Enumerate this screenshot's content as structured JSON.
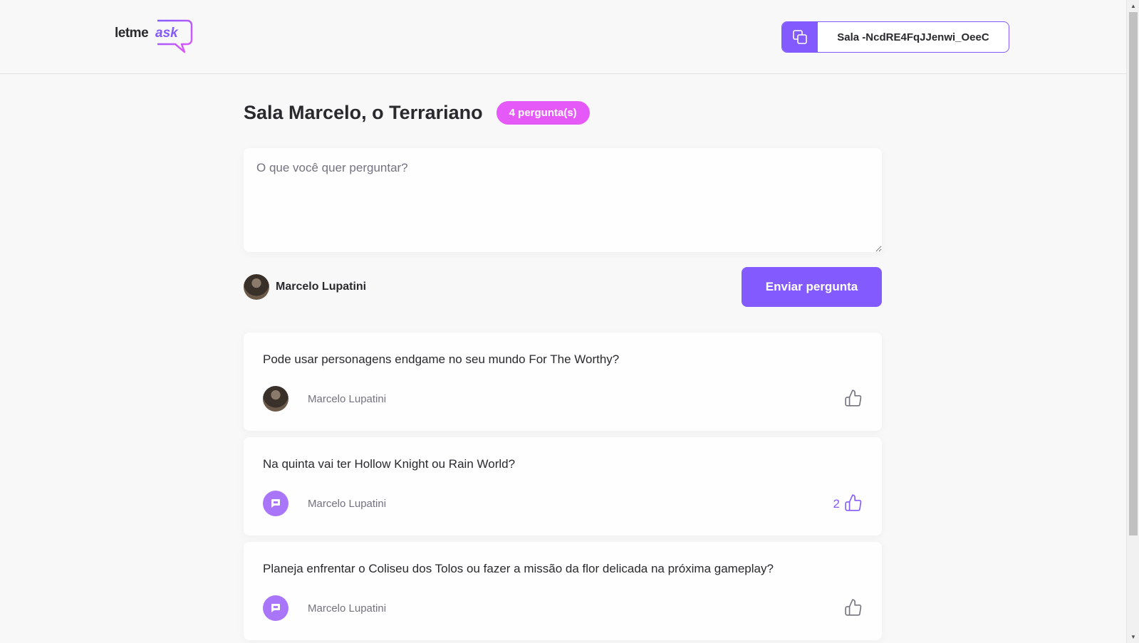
{
  "header": {
    "logo": {
      "prefix": "letme",
      "suffix": "ask"
    },
    "room_code_label": "Sala -NcdRE4FqJJenwi_OeeC",
    "copy_icon": "copy-icon"
  },
  "room": {
    "title": "Sala Marcelo, o Terrariano",
    "question_count": "4 pergunta(s)"
  },
  "form": {
    "placeholder": "O que você quer perguntar?",
    "user_name": "Marcelo Lupatini",
    "send_label": "Enviar pergunta"
  },
  "questions": [
    {
      "text": "Pode usar personagens endgame no seu mundo For The Worthy?",
      "author": "Marcelo Lupatini",
      "avatar": "photo",
      "likes": ""
    },
    {
      "text": "Na quinta vai ter Hollow Knight ou Rain World?",
      "author": "Marcelo Lupatini",
      "avatar": "default",
      "likes": "2"
    },
    {
      "text": "Planeja enfrentar o Coliseu dos Tolos ou fazer a missão da flor delicada na próxima gameplay?",
      "author": "Marcelo Lupatini",
      "avatar": "default",
      "likes": ""
    }
  ],
  "colors": {
    "primary": "#835afd",
    "badge": "#e559f9",
    "background": "#f8f8f8"
  }
}
